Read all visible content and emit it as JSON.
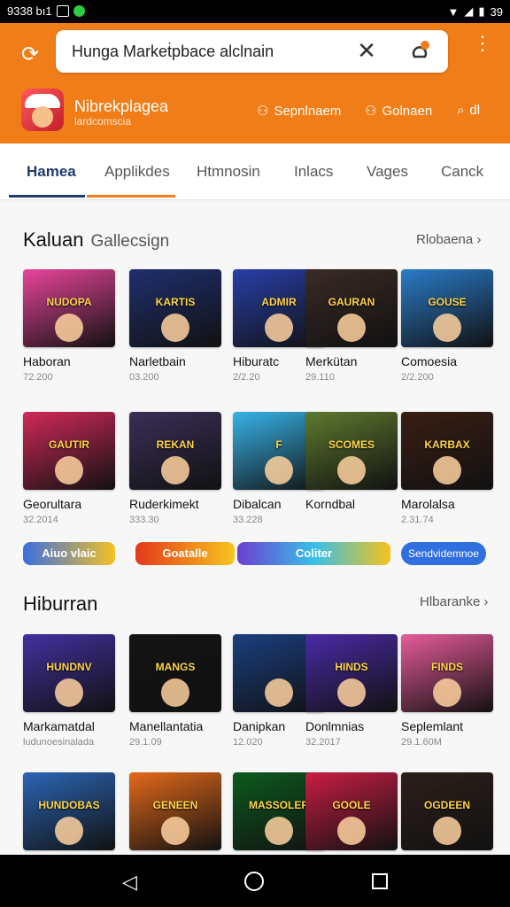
{
  "status": {
    "left": "9338 bı1",
    "right": "39"
  },
  "toolbar": {
    "search_text": "Hunga Markeṫpbace alclnain",
    "close_glyph": "✕",
    "back_glyph": "⟳"
  },
  "header": {
    "app_title": "Nibrekplagea",
    "app_subtitle": "lardcomscia",
    "links": [
      {
        "label": "Sepnlnaem",
        "icon": "person-icon"
      },
      {
        "label": "Golnaen",
        "icon": "person-icon"
      },
      {
        "label": "dl",
        "icon": "search-icon"
      }
    ]
  },
  "tabs": [
    {
      "label": "Hamea"
    },
    {
      "label": "Applikdes"
    },
    {
      "label": "Htmnosin"
    },
    {
      "label": "Inlacs"
    },
    {
      "label": "Vages"
    },
    {
      "label": "Canck"
    }
  ],
  "section1": {
    "title": "Kaluan",
    "subtitle": "Gallecsign",
    "more": "Rlobaena"
  },
  "row1": [
    {
      "name": "Haboran",
      "meta": "72.200",
      "title": "NUDOPA",
      "color": "#e9459b"
    },
    {
      "name": "Narletbain",
      "meta": "03.200",
      "title": "KARTIS",
      "color": "#1f2f6e"
    },
    {
      "name": "Hiburatc",
      "meta": "2/2.20",
      "title": "ADMIR",
      "color": "#283fa8"
    },
    {
      "name": "Merkütan",
      "meta": "29.110",
      "title": "GAURAN",
      "color": "#3a2a25"
    },
    {
      "name": "Comoesia",
      "meta": "2/2.200",
      "title": "GOUSE",
      "color": "#2a7cc9"
    }
  ],
  "row2": [
    {
      "name": "Georultara",
      "meta": "32.2014",
      "title": "GAUTIR",
      "color": "#d1295a"
    },
    {
      "name": "Ruderkimekt",
      "meta": "333.30",
      "title": "REKAN",
      "color": "#3b2f58"
    },
    {
      "name": "Dibalcan",
      "meta": "33.228",
      "title": "F",
      "color": "#37b4e9"
    },
    {
      "name": "Korndbal",
      "meta": "",
      "title": "SCOMES",
      "color": "#5e7a2e"
    },
    {
      "name": "Marolalsa",
      "meta": "2.31.74",
      "title": "KARBAX",
      "color": "#3a1e14"
    }
  ],
  "strips": [
    "Aiuo vlaic",
    "Goatalle",
    "Coliter"
  ],
  "strip_button": "Sendvidemnoe",
  "section2": {
    "title": "Hiburran",
    "more": "Hlbaranke"
  },
  "row3": [
    {
      "name": "Markamatdal",
      "meta": "ludunoesinalada",
      "title": "HUNDNV",
      "color": "#4430a0"
    },
    {
      "name": "Manellantatia",
      "meta": "29.1.09",
      "title": "MANGS",
      "color": "#141414"
    },
    {
      "name": "Danipkan",
      "meta": "12.020",
      "title": "",
      "color": "#1a3f80"
    },
    {
      "name": "Donlmnias",
      "meta": "32.2017",
      "title": "HINDS",
      "color": "#4a2aa6"
    },
    {
      "name": "Seplemlant",
      "meta": "29.1.60M",
      "title": "FINDS",
      "color": "#e85b9a"
    }
  ],
  "row4": [
    {
      "title": "HUNDOBAS",
      "color": "#2b66b5"
    },
    {
      "title": "GENEEN",
      "color": "#e46a1a"
    },
    {
      "title": "MASSOLER",
      "color": "#0d5a1e"
    },
    {
      "title": "GOOLE",
      "color": "#c91d44"
    },
    {
      "title": "OGDEEN",
      "color": "#2c1f1a"
    }
  ]
}
